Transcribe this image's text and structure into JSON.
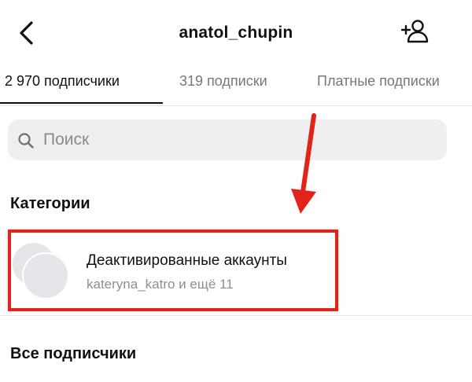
{
  "header": {
    "title": "anatol_chupin",
    "back_icon": "chevron-left-icon",
    "add_icon": "add-person-icon"
  },
  "tabs": [
    {
      "label": "2 970 подписчики",
      "active": true
    },
    {
      "label": "319 подписки",
      "active": false
    },
    {
      "label": "Платные подписки",
      "active": false
    }
  ],
  "search": {
    "placeholder": "Поиск",
    "icon": "search-icon"
  },
  "categories": {
    "title": "Категории",
    "items": [
      {
        "name": "Деактивированные аккаунты",
        "subtitle": "kateryna_katro и ещё 11"
      }
    ]
  },
  "all_followers": {
    "title": "Все подписчики"
  },
  "annotation": {
    "color": "#e2231a",
    "arrow_icon": "red-arrow"
  }
}
